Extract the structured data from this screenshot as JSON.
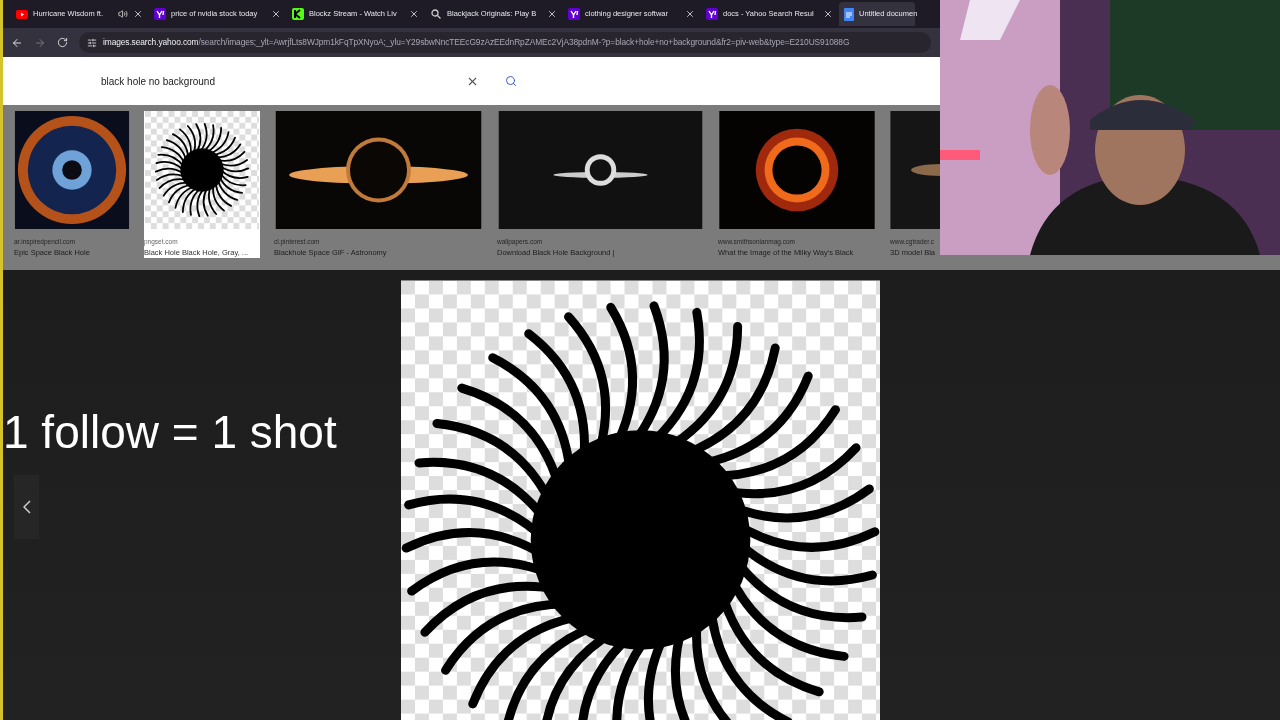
{
  "browser": {
    "tabs": [
      {
        "title": "Hurricane Wisdom ft.",
        "kind": "video",
        "audio": true,
        "selected": false
      },
      {
        "title": "price of nvidia stock today",
        "kind": "yahoo",
        "audio": false,
        "selected": false
      },
      {
        "title": "Blockz Stream - Watch Liv",
        "kind": "stream",
        "audio": false,
        "selected": false
      },
      {
        "title": "Blackjack Originals: Play B",
        "kind": "search",
        "audio": false,
        "selected": false
      },
      {
        "title": "clothing designer softwar",
        "kind": "yahoo",
        "audio": false,
        "selected": false
      },
      {
        "title": "docs - Yahoo Search Resul",
        "kind": "yahoo",
        "audio": false,
        "selected": false
      },
      {
        "title": "Untitled documen",
        "kind": "doc",
        "audio": false,
        "selected": true
      }
    ],
    "url_host": "images.search.yahoo.com",
    "url_path": "/search/images;_ylt=AwrjfLts8WJpm1kFqTpXNyoA;_ylu=Y29sbwNncTEEcG9zAzEEdnRpZAMEc2VjA38pdnM-?p=black+hole+no+background&fr2=piv-web&type=E210US91088G"
  },
  "search": {
    "value": "black hole no background"
  },
  "thumbnails": [
    {
      "source": "ar.inspiredpencil.com",
      "title": "Epic Space Black Hole",
      "selected": false
    },
    {
      "source": "pngset.com",
      "title": "Black Hole Black Hole, Gray, ...",
      "selected": true
    },
    {
      "source": "cl.pinterest.com",
      "title": "Blackhole Space GIF - Astronomy",
      "selected": false
    },
    {
      "source": "wallpapers.com",
      "title": "Download Black Hole Background |",
      "selected": false
    },
    {
      "source": "www.smithsonianmag.com",
      "title": "What the Image of the Milky Way's Black",
      "selected": false
    },
    {
      "source": "www.cgtrader.c",
      "title": "3D model Bla",
      "selected": false
    }
  ],
  "overlay_text": "1 follow = 1 shot"
}
